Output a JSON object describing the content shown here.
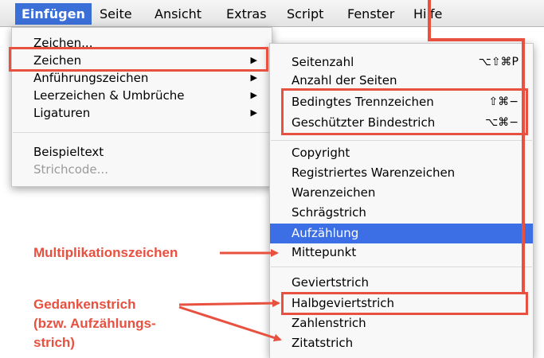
{
  "menubar": {
    "items": [
      "Einfügen",
      "Seite",
      "Ansicht",
      "Extras",
      "Script",
      "Fenster",
      "Hilfe"
    ],
    "active_index": 0
  },
  "main_menu": {
    "items": [
      {
        "label": "Zeichen...",
        "state": "normal"
      },
      {
        "label": "Zeichen",
        "state": "submenu",
        "arrow": "▶"
      },
      {
        "label": "Anführungszeichen",
        "state": "submenu",
        "arrow": "▶"
      },
      {
        "label": "Leerzeichen & Umbrüche",
        "state": "submenu",
        "arrow": "▶"
      },
      {
        "label": "Ligaturen",
        "state": "submenu",
        "arrow": "▶"
      },
      {
        "label": "Beispieltext",
        "state": "normal"
      },
      {
        "label": "Strichcode...",
        "state": "disabled"
      }
    ]
  },
  "submenu": {
    "items": [
      {
        "label": "Seitenzahl",
        "shortcut": "⌥⇧⌘P"
      },
      {
        "label": "Anzahl der Seiten",
        "shortcut": ""
      },
      {
        "label": "Bedingtes Trennzeichen",
        "shortcut": "⇧⌘−"
      },
      {
        "label": "Geschützter Bindestrich",
        "shortcut": "⌥⌘−"
      },
      {
        "label": "Copyright",
        "shortcut": ""
      },
      {
        "label": "Registriertes Warenzeichen",
        "shortcut": ""
      },
      {
        "label": "Warenzeichen",
        "shortcut": ""
      },
      {
        "label": "Schrägstrich",
        "shortcut": ""
      },
      {
        "label": "Aufzählung",
        "shortcut": "",
        "highlighted": true
      },
      {
        "label": "Mittepunkt",
        "shortcut": ""
      },
      {
        "label": "Geviertstrich",
        "shortcut": ""
      },
      {
        "label": "Halbgeviertstrich",
        "shortcut": ""
      },
      {
        "label": "Zahlenstrich",
        "shortcut": ""
      },
      {
        "label": "Zitatstrich",
        "shortcut": ""
      }
    ]
  },
  "annotations": {
    "multiplikation": "Multiplikationszeichen",
    "gedanken_line1": "Gedankenstrich",
    "gedanken_line2": "(bzw. Aufzählungs-",
    "gedanken_line3": "strich)"
  },
  "colors": {
    "accent_red": "#e8503f",
    "menu_highlight": "#3c6ee6",
    "menubar_active": "#3b6fd8"
  }
}
